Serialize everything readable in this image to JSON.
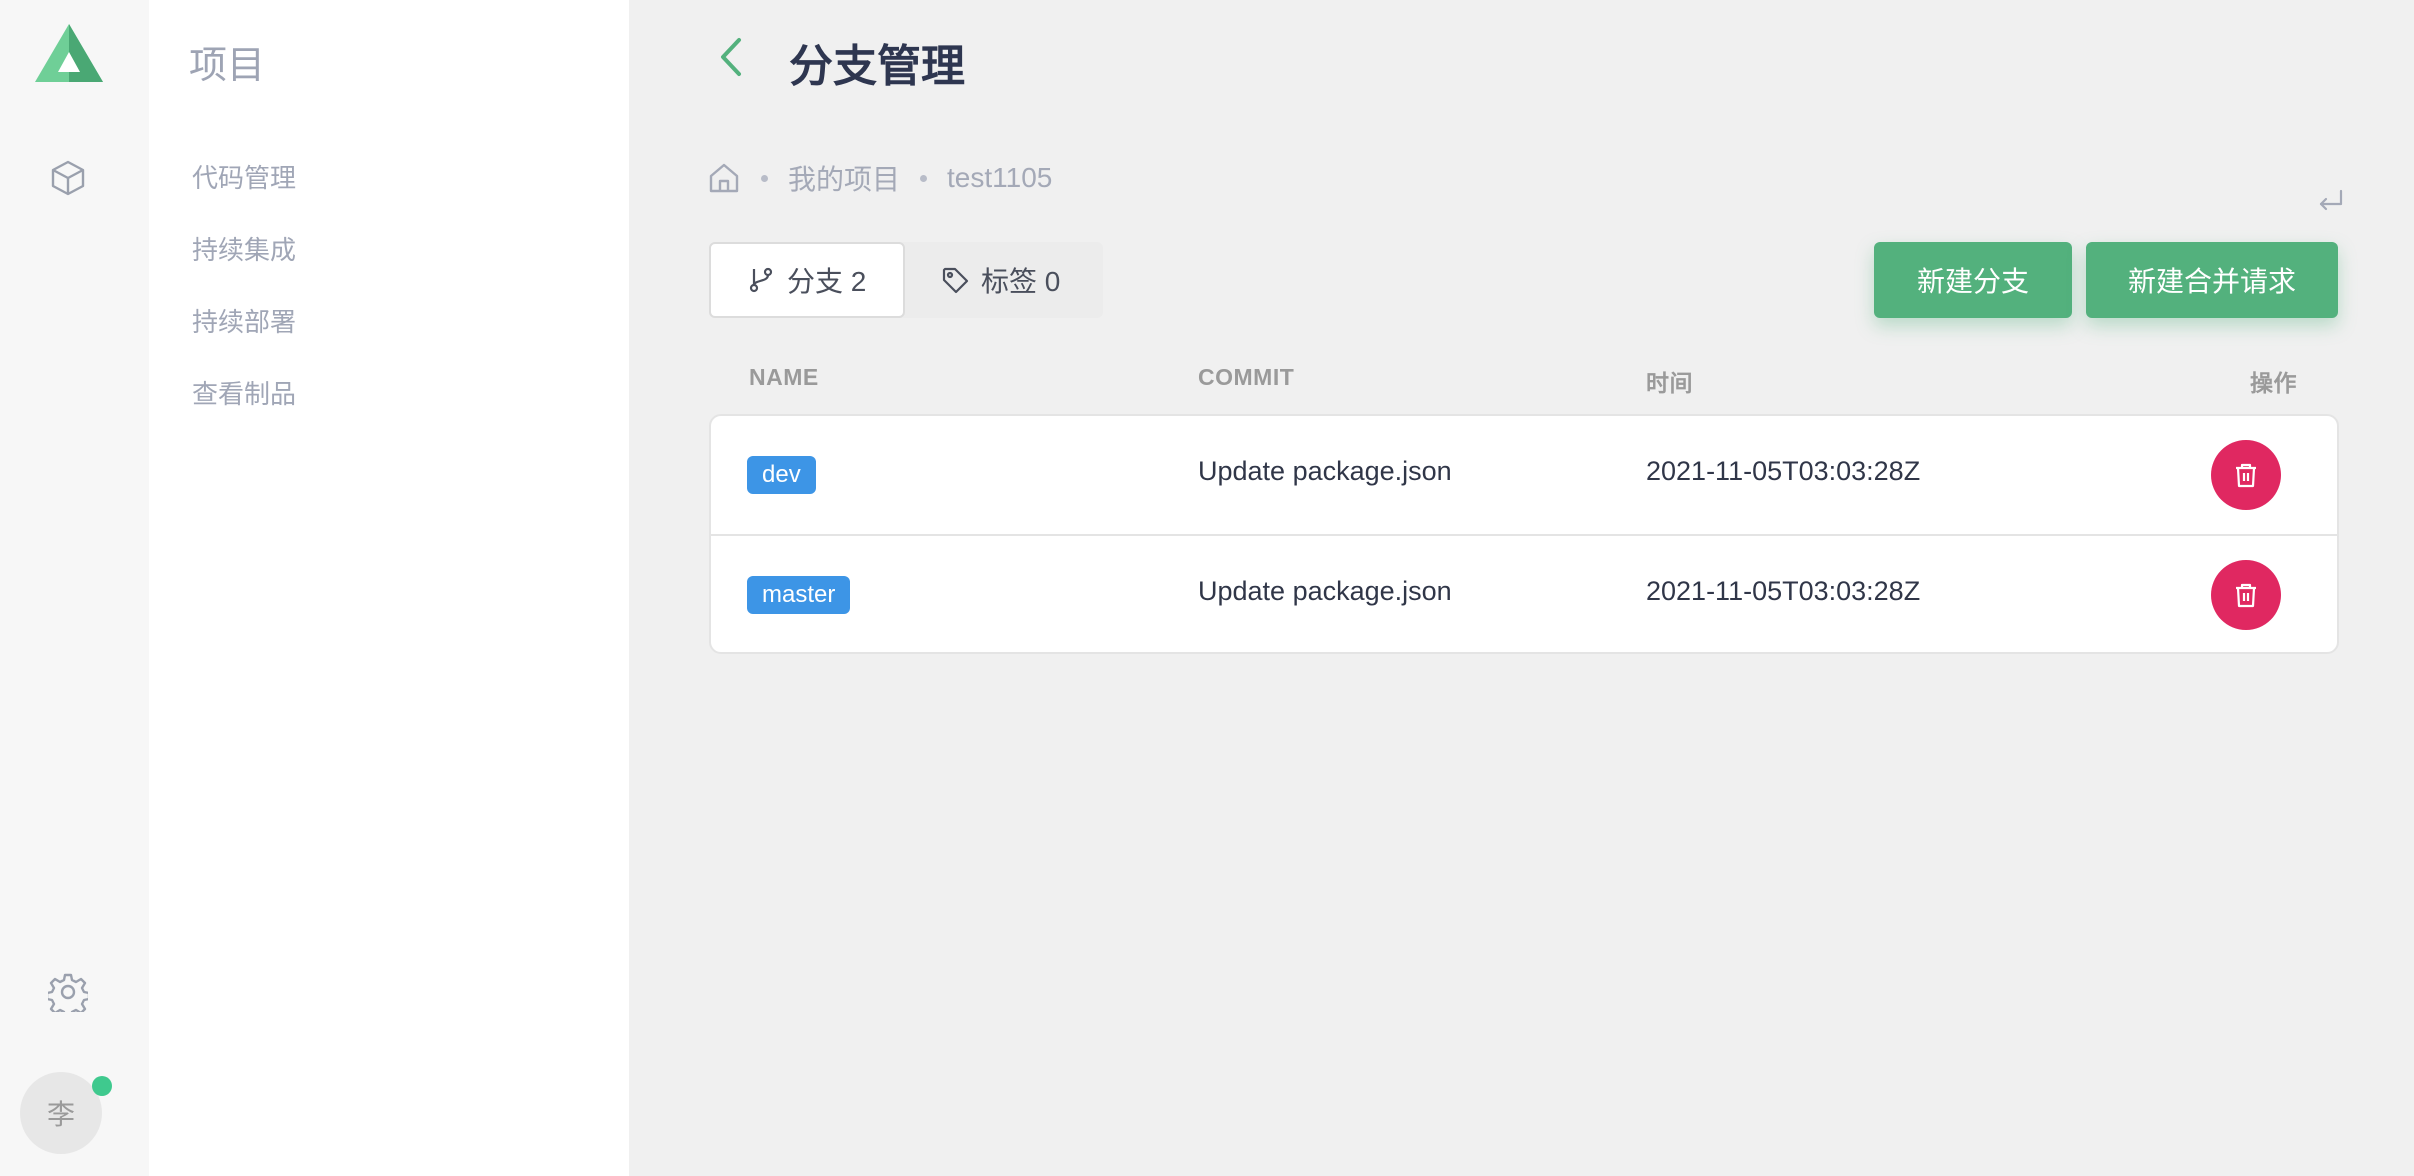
{
  "colors": {
    "accent": "#53b17d",
    "badge": "#3d95e6",
    "danger": "#e02861",
    "title": "#2e3650"
  },
  "rail": {
    "logo_icon": "triangle-logo-icon",
    "nav_icon": "cube-icon",
    "settings_icon": "gear-icon",
    "avatar_text": "李"
  },
  "sidebar": {
    "title": "项目",
    "items": [
      {
        "label": "代码管理"
      },
      {
        "label": "持续集成"
      },
      {
        "label": "持续部署"
      },
      {
        "label": "查看制品"
      }
    ]
  },
  "header": {
    "title": "分支管理",
    "back_icon": "chevron-left-icon"
  },
  "breadcrumb": {
    "home_icon": "home-icon",
    "items": [
      {
        "label": "我的项目"
      },
      {
        "label": "test1105"
      }
    ]
  },
  "tabs": [
    {
      "label": "分支 2",
      "icon": "branch-icon",
      "active": true
    },
    {
      "label": "标签 0",
      "icon": "tag-icon",
      "active": false
    }
  ],
  "actions": {
    "new_branch": "新建分支",
    "new_merge_request": "新建合并请求"
  },
  "table": {
    "columns": {
      "name": "NAME",
      "commit": "COMMIT",
      "time": "时间",
      "action": "操作"
    },
    "rows": [
      {
        "name": "dev",
        "commit": "Update package.json",
        "time": "2021-11-05T03:03:28Z"
      },
      {
        "name": "master",
        "commit": "Update package.json",
        "time": "2021-11-05T03:03:28Z"
      }
    ]
  }
}
